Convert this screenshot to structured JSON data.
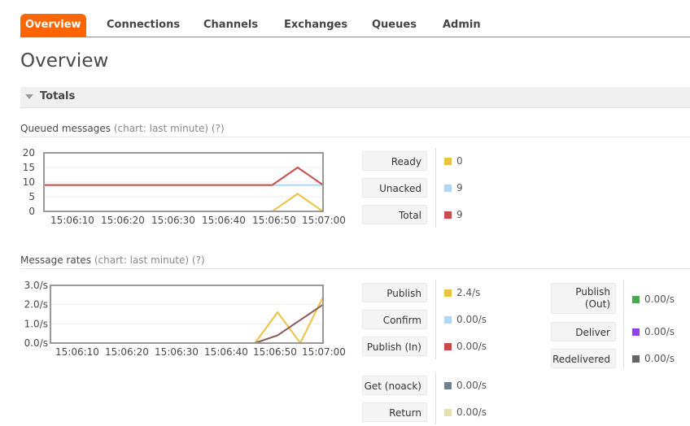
{
  "nav": {
    "tabs": [
      "Overview",
      "Connections",
      "Channels",
      "Exchanges",
      "Queues",
      "Admin"
    ]
  },
  "page_title": "Overview",
  "totals_label": "Totals",
  "queued": {
    "title": "Queued messages",
    "chart_link": "(chart: last minute)",
    "help": "(?)",
    "stats": [
      {
        "label": "Ready",
        "value": "0",
        "color": "#edc240"
      },
      {
        "label": "Unacked",
        "value": "9",
        "color": "#afd8f8"
      },
      {
        "label": "Total",
        "value": "9",
        "color": "#cb4b4b"
      }
    ]
  },
  "rates": {
    "title": "Message rates",
    "chart_link": "(chart: last minute)",
    "help": "(?)",
    "stats_col1": [
      {
        "label": "Publish",
        "value": "2.4/s",
        "color": "#edc240"
      },
      {
        "label": "Confirm",
        "value": "0.00/s",
        "color": "#afd8f8"
      },
      {
        "label": "Publish (In)",
        "value": "0.00/s",
        "color": "#cb4b4b"
      }
    ],
    "stats_col1b": [
      {
        "label": "Get (noack)",
        "value": "0.00/s",
        "color": "#708090"
      },
      {
        "label": "Return",
        "value": "0.00/s",
        "color": "#e8e0b0"
      }
    ],
    "stats_col2": [
      {
        "label_line1": "Publish",
        "label_line2": "(Out)",
        "value": "0.00/s",
        "color": "#4da74d"
      },
      {
        "label": "Deliver",
        "value": "0.00/s",
        "color": "#9440ed"
      },
      {
        "label": "Redelivered",
        "value": "0.00/s",
        "color": "#666666"
      }
    ]
  },
  "chart_data": [
    {
      "type": "line",
      "x": [
        "15:06:05",
        "15:06:10",
        "15:06:15",
        "15:06:20",
        "15:06:25",
        "15:06:30",
        "15:06:35",
        "15:06:40",
        "15:06:45",
        "15:06:50",
        "15:06:55",
        "15:07:00",
        "15:07:05"
      ],
      "xticks": [
        "15:06:10",
        "15:06:20",
        "15:06:30",
        "15:06:40",
        "15:06:50",
        "15:07:00"
      ],
      "yticks": [
        "0",
        "5",
        "10",
        "15",
        "20"
      ],
      "ylim": [
        0,
        20
      ],
      "series": [
        {
          "name": "Ready",
          "color": "#edc240",
          "values": [
            0,
            0,
            0,
            0,
            0,
            0,
            0,
            0,
            0,
            0,
            6,
            0
          ]
        },
        {
          "name": "Unacked",
          "color": "#afd8f8",
          "values": [
            9,
            9,
            9,
            9,
            9,
            9,
            9,
            9,
            9,
            9,
            9,
            9
          ]
        },
        {
          "name": "Total",
          "color": "#cb4b4b",
          "values": [
            9,
            9,
            9,
            9,
            9,
            9,
            9,
            9,
            9,
            9,
            15,
            9
          ]
        }
      ]
    },
    {
      "type": "line",
      "xticks": [
        "15:06:10",
        "15:06:20",
        "15:06:30",
        "15:06:40",
        "15:06:50",
        "15:07:00"
      ],
      "yticks": [
        "0.0/s",
        "1.0/s",
        "2.0/s",
        "3.0/s"
      ],
      "ylim": [
        0,
        3
      ],
      "series": [
        {
          "name": "Publish",
          "color": "#edc240",
          "values": [
            0,
            0,
            0,
            0,
            0,
            0,
            0,
            0,
            0,
            0,
            1.6,
            0,
            2.4
          ]
        },
        {
          "name": "Publish (In)",
          "color": "#8b5a5a",
          "values": [
            0,
            0,
            0,
            0,
            0,
            0,
            0,
            0,
            0,
            0,
            0.4,
            1.2,
            2.0
          ]
        }
      ]
    }
  ]
}
